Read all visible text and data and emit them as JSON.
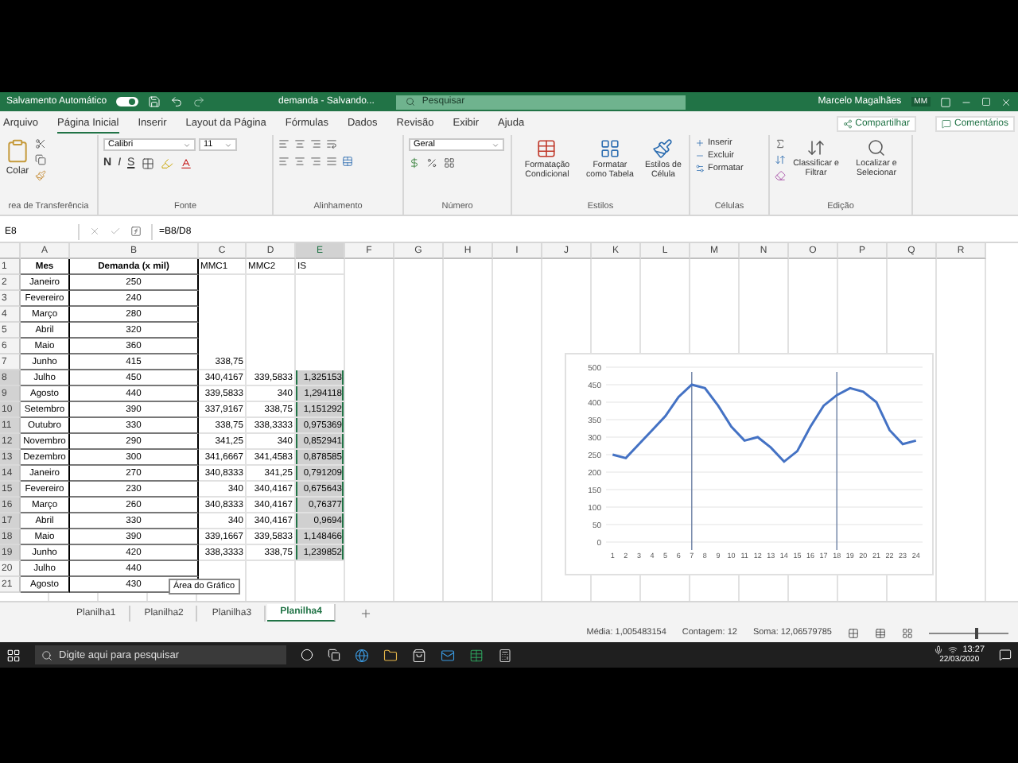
{
  "title_bar": {
    "autosave_label": "Salvamento Automático",
    "autosave_on": true,
    "document": "demanda - Salvando...",
    "search_placeholder": "Pesquisar",
    "user": "Marcelo Magalhães",
    "initials": "MM"
  },
  "ribbon_tabs": [
    {
      "label": "Arquivo",
      "selected": false
    },
    {
      "label": "Página Inicial",
      "selected": true
    },
    {
      "label": "Inserir",
      "selected": false
    },
    {
      "label": "Layout da Página",
      "selected": false
    },
    {
      "label": "Fórmulas",
      "selected": false
    },
    {
      "label": "Dados",
      "selected": false
    },
    {
      "label": "Revisão",
      "selected": false
    },
    {
      "label": "Exibir",
      "selected": false
    },
    {
      "label": "Ajuda",
      "selected": false
    }
  ],
  "ribbon_actions": [
    "Compartilhar",
    "Comentários"
  ],
  "ribbon": {
    "clipboard": {
      "paste": "Colar",
      "group": "rea de Transferência"
    },
    "font": {
      "name": "Calibri",
      "size": "11",
      "styles": [
        "N",
        "I",
        "S"
      ],
      "group": "Fonte"
    },
    "alignment": {
      "group": "Alinhamento"
    },
    "number": {
      "format": "Geral",
      "group": "Número"
    },
    "styles": {
      "items": [
        "Formatação Condicional",
        "Formatar como Tabela",
        "Estilos de Célula"
      ],
      "group": "Estilos"
    },
    "cells": {
      "items": [
        "Inserir",
        "Excluir",
        "Formatar"
      ],
      "group": "Células"
    },
    "editing": {
      "items": [
        "Classificar e Filtrar",
        "Localizar e Selecionar"
      ],
      "group": "Edição"
    }
  },
  "formula_bar": {
    "name_box": "E8",
    "formula": "=B8/D8"
  },
  "columns": [
    "A",
    "B",
    "C",
    "D",
    "E",
    "F",
    "G",
    "H",
    "I",
    "J",
    "K",
    "L",
    "M",
    "N",
    "O",
    "P",
    "Q",
    "R"
  ],
  "header_row": {
    "number": "1",
    "cells": [
      "Mes",
      "Demanda (x mil)",
      "MMC1",
      "MMC2",
      "IS"
    ]
  },
  "rows": [
    {
      "number": "2",
      "mes": "Janeiro",
      "demanda": "250",
      "selected": false
    },
    {
      "number": "3",
      "mes": "Fevereiro",
      "demanda": "240",
      "selected": false
    },
    {
      "number": "4",
      "mes": "Março",
      "demanda": "280",
      "selected": false
    },
    {
      "number": "5",
      "mes": "Abril",
      "demanda": "320",
      "selected": false
    },
    {
      "number": "6",
      "mes": "Maio",
      "demanda": "360",
      "selected": false
    },
    {
      "number": "7",
      "mes": "Junho",
      "demanda": "415",
      "mmc1": "338,75",
      "selected": false
    },
    {
      "number": "8",
      "mes": "Julho",
      "demanda": "450",
      "mmc1": "340,4167",
      "mmc2": "339,5833",
      "is": "1,325153",
      "selected": true
    },
    {
      "number": "9",
      "mes": "Agosto",
      "demanda": "440",
      "mmc1": "339,5833",
      "mmc2": "340",
      "is": "1,294118",
      "selected": true
    },
    {
      "number": "10",
      "mes": "Setembro",
      "demanda": "390",
      "mmc1": "337,9167",
      "mmc2": "338,75",
      "is": "1,151292",
      "selected": true
    },
    {
      "number": "11",
      "mes": "Outubro",
      "demanda": "330",
      "mmc1": "338,75",
      "mmc2": "338,3333",
      "is": "0,975369",
      "selected": true
    },
    {
      "number": "12",
      "mes": "Novembro",
      "demanda": "290",
      "mmc1": "341,25",
      "mmc2": "340",
      "is": "0,852941",
      "selected": true
    },
    {
      "number": "13",
      "mes": "Dezembro",
      "demanda": "300",
      "mmc1": "341,6667",
      "mmc2": "341,4583",
      "is": "0,878585",
      "selected": true
    },
    {
      "number": "14",
      "mes": "Janeiro",
      "demanda": "270",
      "mmc1": "340,8333",
      "mmc2": "341,25",
      "is": "0,791209",
      "selected": true
    },
    {
      "number": "15",
      "mes": "Fevereiro",
      "demanda": "230",
      "mmc1": "340",
      "mmc2": "340,4167",
      "is": "0,675643",
      "selected": true
    },
    {
      "number": "16",
      "mes": "Março",
      "demanda": "260",
      "mmc1": "340,8333",
      "mmc2": "340,4167",
      "is": "0,76377",
      "selected": true
    },
    {
      "number": "17",
      "mes": "Abril",
      "demanda": "330",
      "mmc1": "340",
      "mmc2": "340,4167",
      "is": "0,9694",
      "selected": true
    },
    {
      "number": "18",
      "mes": "Maio",
      "demanda": "390",
      "mmc1": "339,1667",
      "mmc2": "339,5833",
      "is": "1,148466",
      "selected": true
    },
    {
      "number": "19",
      "mes": "Junho",
      "demanda": "420",
      "mmc1": "338,3333",
      "mmc2": "338,75",
      "is": "1,239852",
      "selected": true
    },
    {
      "number": "20",
      "mes": "Julho",
      "demanda": "440",
      "selected": false
    },
    {
      "number": "21",
      "mes": "Agosto",
      "demanda": "430",
      "selected": false
    }
  ],
  "chart_data": {
    "type": "line",
    "x": [
      1,
      2,
      3,
      4,
      5,
      6,
      7,
      8,
      9,
      10,
      11,
      12,
      13,
      14,
      15,
      16,
      17,
      18,
      19,
      20,
      21,
      22,
      23,
      24
    ],
    "series": [
      {
        "color": "#4472c4",
        "values": [
          250,
          240,
          280,
          320,
          360,
          415,
          450,
          440,
          390,
          330,
          290,
          300,
          270,
          230,
          260,
          330,
          390,
          420,
          440,
          430,
          400,
          320,
          280,
          290
        ]
      }
    ],
    "xticks": [
      1,
      2,
      3,
      4,
      5,
      6,
      7,
      8,
      9,
      10,
      11,
      12,
      13,
      14,
      15,
      16,
      17,
      18,
      19,
      20,
      21,
      22,
      23,
      24
    ],
    "xlim": [
      0.5,
      24.5
    ],
    "ylim": [
      0,
      500
    ],
    "yticks": [
      0,
      50,
      100,
      150,
      200,
      250,
      300,
      350,
      400,
      450,
      500
    ],
    "grid": true,
    "ref_lines": [
      {
        "axis": "x",
        "value": 7
      },
      {
        "axis": "x",
        "value": 18
      }
    ]
  },
  "tooltip": "Área do Gráfico",
  "sheet_tabs": [
    {
      "label": "Planilha1",
      "selected": false
    },
    {
      "label": "Planilha2",
      "selected": false
    },
    {
      "label": "Planilha3",
      "selected": false
    },
    {
      "label": "Planilha4",
      "selected": true
    }
  ],
  "status_bar": {
    "average": "Média: 1,005483154",
    "count": "Contagem: 12",
    "sum": "Soma: 12,06579785"
  },
  "zoom": {
    "level": 0.6
  },
  "taskbar": {
    "search_placeholder": "Digite aqui para pesquisar",
    "time": "13:27",
    "date": "22/03/2020"
  }
}
